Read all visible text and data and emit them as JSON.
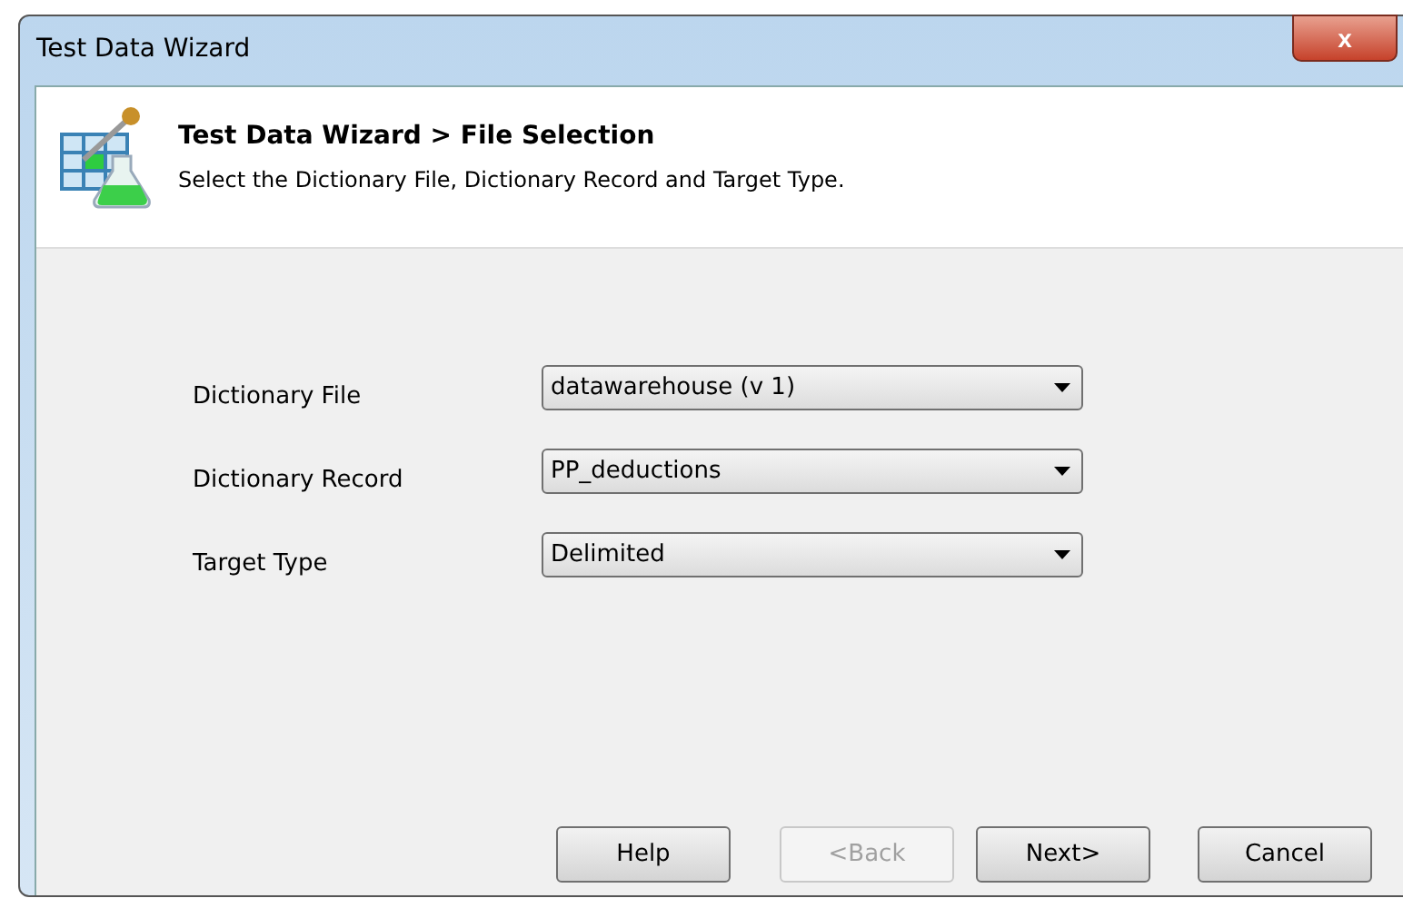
{
  "window": {
    "title": "Test Data Wizard",
    "close": "x"
  },
  "header": {
    "title": "Test Data Wizard > File Selection",
    "subtitle": "Select the Dictionary File, Dictionary Record and Target Type."
  },
  "fields": [
    {
      "label": "Dictionary File",
      "value": "datawarehouse (v 1)"
    },
    {
      "label": "Dictionary Record",
      "value": "PP_deductions"
    },
    {
      "label": "Target Type",
      "value": "Delimited"
    }
  ],
  "buttons": [
    {
      "label": "Help",
      "disabled": false
    },
    {
      "label": "<Back",
      "disabled": true
    },
    {
      "label": "Next>",
      "disabled": false
    },
    {
      "label": "Cancel",
      "disabled": false
    }
  ]
}
